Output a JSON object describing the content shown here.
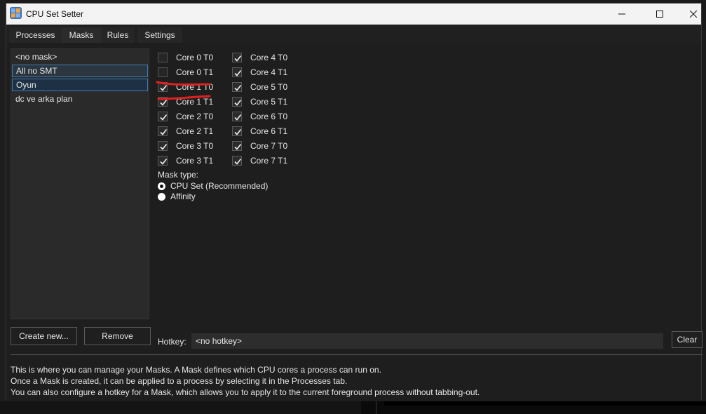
{
  "window": {
    "title": "CPU Set Setter"
  },
  "tabs": [
    {
      "label": "Processes",
      "active": false
    },
    {
      "label": "Masks",
      "active": true
    },
    {
      "label": "Rules",
      "active": false
    },
    {
      "label": "Settings",
      "active": false
    }
  ],
  "masks": {
    "items": [
      {
        "label": "<no mask>"
      },
      {
        "label": "All no SMT"
      },
      {
        "label": "Oyun"
      },
      {
        "label": "dc ve arka plan"
      }
    ],
    "selected": "Oyun"
  },
  "cores": {
    "left": [
      {
        "label": "Core 0 T0",
        "checked": false
      },
      {
        "label": "Core 0 T1",
        "checked": false
      },
      {
        "label": "Core 1 T0",
        "checked": true
      },
      {
        "label": "Core 1 T1",
        "checked": true
      },
      {
        "label": "Core 2 T0",
        "checked": true
      },
      {
        "label": "Core 2 T1",
        "checked": true
      },
      {
        "label": "Core 3 T0",
        "checked": true
      },
      {
        "label": "Core 3 T1",
        "checked": true
      }
    ],
    "right": [
      {
        "label": "Core 4 T0",
        "checked": true
      },
      {
        "label": "Core 4 T1",
        "checked": true
      },
      {
        "label": "Core 5 T0",
        "checked": true
      },
      {
        "label": "Core 5 T1",
        "checked": true
      },
      {
        "label": "Core 6 T0",
        "checked": true
      },
      {
        "label": "Core 6 T1",
        "checked": true
      },
      {
        "label": "Core 7 T0",
        "checked": true
      },
      {
        "label": "Core 7 T1",
        "checked": true
      }
    ]
  },
  "mask_type": {
    "label": "Mask type:",
    "options": [
      {
        "label": "CPU Set (Recommended)",
        "selected": true
      },
      {
        "label": "Affinity",
        "selected": false
      }
    ]
  },
  "buttons": {
    "create": "Create new...",
    "remove": "Remove",
    "clear": "Clear"
  },
  "hotkey": {
    "label": "Hotkey:",
    "value": "<no hotkey>"
  },
  "help": [
    "This is where you can manage your Masks. A Mask defines which CPU cores a process can run on.",
    "Once a Mask is created, it can be applied to a process by selecting it in the Processes tab.",
    "You can also configure a hotkey for a Mask, which allows you to apply it to the current foreground process without tabbing-out."
  ],
  "colors": {
    "annotation": "#e0201e",
    "selection_border": "#3e7ab3"
  }
}
